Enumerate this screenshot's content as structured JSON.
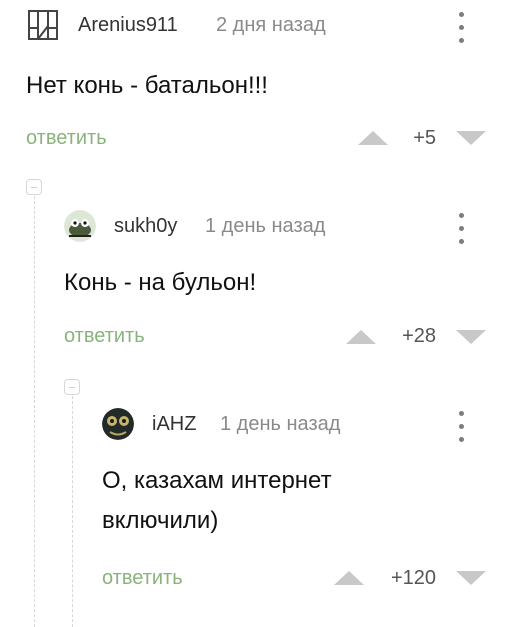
{
  "comments": [
    {
      "username": "Arenius911",
      "time": "2 дня назад",
      "text": "Нет конь - батальон!!!",
      "reply_label": "ответить",
      "score": "+5",
      "avatar_icon": "rammstein-logo-icon"
    },
    {
      "username": "sukh0y",
      "time": "1 день назад",
      "text": "Конь - на бульон!",
      "reply_label": "ответить",
      "score": "+28",
      "avatar_icon": "cartoon-avatar-icon"
    },
    {
      "username": "iAHZ",
      "time": "1 день назад",
      "text_line1": "О, казахам интернет",
      "text_line2": "включили)",
      "reply_label": "ответить",
      "score": "+120",
      "avatar_icon": "dark-avatar-icon"
    }
  ],
  "colors": {
    "reply": "#8ab37c",
    "vote_arrows": "#c8c8c8",
    "thread_line": "#d7d7d7"
  }
}
